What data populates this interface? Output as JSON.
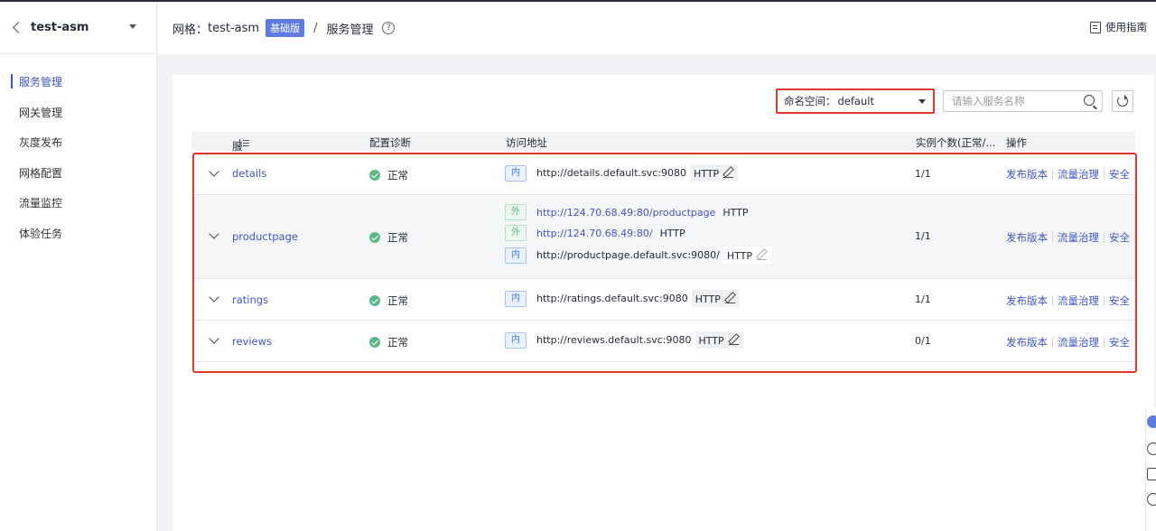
{
  "sidebar": {
    "title": "test-asm",
    "items": [
      {
        "label": "服务管理",
        "active": true
      },
      {
        "label": "网关管理"
      },
      {
        "label": "灰度发布"
      },
      {
        "label": "网格配置"
      },
      {
        "label": "流量监控"
      },
      {
        "label": "体验任务"
      }
    ]
  },
  "header": {
    "mesh_label": "网格：",
    "mesh_name": "test-asm",
    "edition_badge": "基础版",
    "separator": "/",
    "page_title": "服务管理",
    "guide_label": "使用指南"
  },
  "toolbar": {
    "namespace_label": "命名空间：",
    "namespace_value": "default",
    "search_placeholder": "请输入服务名称"
  },
  "table": {
    "columns": [
      "服务名称",
      "配置诊断",
      "访问地址",
      "实例个数(正常/...",
      "操作"
    ],
    "rows": [
      {
        "name": "details",
        "diagnosis": "正常",
        "addresses": [
          {
            "type": "内",
            "url": "http://details.default.svc:9080",
            "protocol": "HTTP"
          }
        ],
        "instances": "1/1",
        "ops": [
          "发布版本",
          "流量治理",
          "安全"
        ]
      },
      {
        "name": "productpage",
        "diagnosis": "正常",
        "addresses": [
          {
            "type": "外",
            "url": "http://124.70.68.49:80/productpage",
            "protocol": "HTTP"
          },
          {
            "type": "外",
            "url": "http://124.70.68.49:80/",
            "protocol": "HTTP"
          },
          {
            "type": "内",
            "url": "http://productpage.default.svc:9080/",
            "protocol": "HTTP"
          }
        ],
        "instances": "1/1",
        "ops": [
          "发布版本",
          "流量治理",
          "安全"
        ]
      },
      {
        "name": "ratings",
        "diagnosis": "正常",
        "addresses": [
          {
            "type": "内",
            "url": "http://ratings.default.svc:9080",
            "protocol": "HTTP"
          }
        ],
        "instances": "1/1",
        "ops": [
          "发布版本",
          "流量治理",
          "安全"
        ]
      },
      {
        "name": "reviews",
        "diagnosis": "正常",
        "addresses": [
          {
            "type": "内",
            "url": "http://reviews.default.svc:9080",
            "protocol": "HTTP"
          }
        ],
        "instances": "0/1",
        "ops": [
          "发布版本",
          "流量治理",
          "安全"
        ]
      }
    ]
  },
  "colors": {
    "accent": "#3f56c2",
    "highlight_border": "#e0372d",
    "status_ok": "#5cb887",
    "badge": "#5e7ce0"
  }
}
